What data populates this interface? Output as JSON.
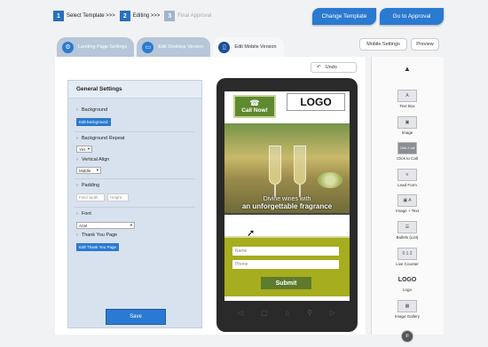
{
  "steps": [
    {
      "num": "1",
      "label": "Select Template >>>"
    },
    {
      "num": "2",
      "label": "Editing >>>"
    },
    {
      "num": "3",
      "label": "Final Approval"
    }
  ],
  "header": {
    "change_template": "Change Template",
    "go_to_approval": "Go to Approval"
  },
  "tabs": [
    {
      "label": "Landing Page Settings",
      "icon": "gear-icon"
    },
    {
      "label": "Edit Desktop Version",
      "icon": "monitor-icon"
    },
    {
      "label": "Edit Mobile Version",
      "icon": "mobile-icon"
    }
  ],
  "toolbar": {
    "mobile_settings": "Mobile Settings",
    "preview": "Preview",
    "undo": "Undo"
  },
  "settings": {
    "title": "General Settings",
    "background": "Background",
    "edit_background": "Edit background",
    "background_repeat": "Background Repeat",
    "repeat_value": "Yes",
    "vertical_align": "Vertical Align",
    "align_value": "Middle",
    "padding": "Padding",
    "field_width": "Field width",
    "height": "Height",
    "font": "Font",
    "font_value": "Arial",
    "thank_you": "Thank You Page",
    "edit_thank_you": "Edit Thank You Page",
    "save": "Save"
  },
  "mobile": {
    "call_label": "Call Now!",
    "logo": "LOGO",
    "hero_line1": "Divine wines with",
    "hero_line2": "an unforgettable fragrance",
    "name_placeholder": "Name",
    "phone_placeholder": "Phone",
    "submit": "Submit"
  },
  "widgets": [
    {
      "label": "Text Box",
      "icon": "A"
    },
    {
      "label": "Image",
      "icon": "▣"
    },
    {
      "label": "Click to Call",
      "icon": "Click 2 call"
    },
    {
      "label": "Lead Form",
      "icon": "≡"
    },
    {
      "label": "Image + Text",
      "icon": "▣ A"
    },
    {
      "label": "Bullets (List)",
      "icon": "☰"
    },
    {
      "label": "Live Counter",
      "icon": "0 1 2"
    },
    {
      "label": "Logo",
      "icon": "LOGO"
    },
    {
      "label": "Image Gallery",
      "icon": "▦"
    },
    {
      "label": "",
      "icon": "✆"
    }
  ]
}
